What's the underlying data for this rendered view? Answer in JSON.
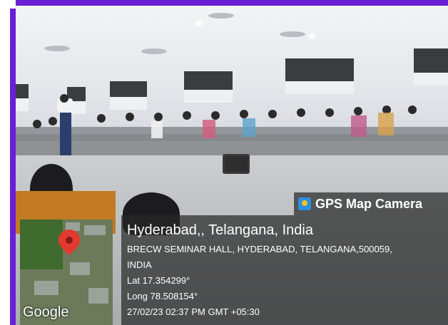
{
  "photo": {
    "description_icon": "room-photo",
    "overlay_tag": {
      "icon": "gps-map-camera-icon",
      "label": "GPS Map Camera"
    },
    "location": {
      "title": "Hyderabad,, Telangana, India",
      "address_line1": "BRECW SEMINAR HALL, HYDERABAD, TELANGANA,500059,",
      "address_line2": "INDIA",
      "lat": "Lat 17.354299°",
      "long": "Long 78.508154°",
      "datetime": "27/02/23 02:37 PM GMT +05:30"
    },
    "map": {
      "brand": "Google",
      "pin_icon": "map-pin-icon"
    }
  }
}
